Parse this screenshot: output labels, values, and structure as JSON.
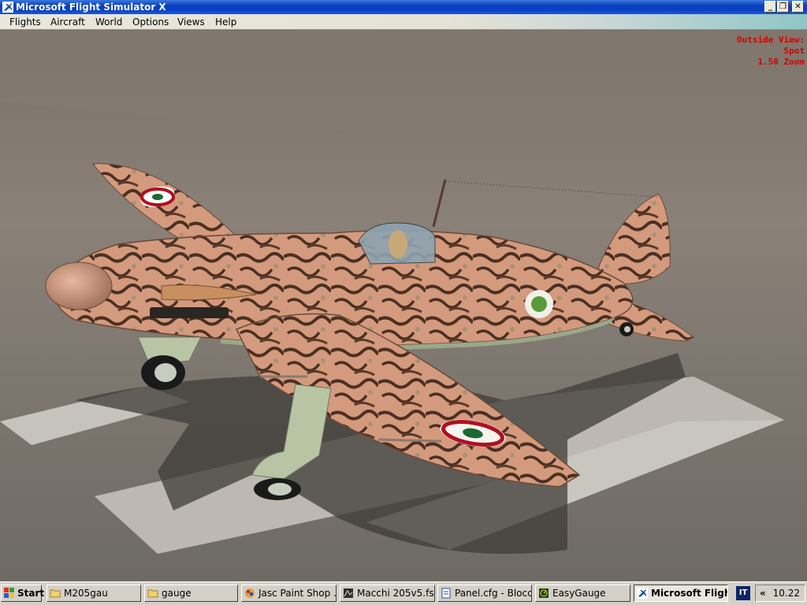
{
  "window": {
    "title": "Microsoft Flight Simulator X"
  },
  "menu": [
    "Flights",
    "Aircraft",
    "World",
    "Options",
    "Views",
    "Help"
  ],
  "view_info": {
    "line1": "Outside View:",
    "line2": "Spot",
    "line3": "1.50 Zoom"
  },
  "taskbar": {
    "start_label": "Start",
    "tasks": [
      {
        "label": "M205gau",
        "icon": "folder-icon"
      },
      {
        "label": "gauge",
        "icon": "folder-icon"
      },
      {
        "label": "Jasc Paint Shop ...",
        "icon": "paint-shop-icon"
      },
      {
        "label": "Macchi 205v5.fs...",
        "icon": "image-file-icon"
      },
      {
        "label": "Panel.cfg - Blocc...",
        "icon": "notepad-icon"
      },
      {
        "label": "EasyGauge",
        "icon": "easygauge-icon"
      },
      {
        "label": "Microsoft Fligh...",
        "icon": "flight-sim-icon"
      }
    ],
    "language": "IT",
    "chevron": "«",
    "clock": "10.22"
  },
  "colors": {
    "view_info": "#d40000",
    "titlebar": "#0a3fb8",
    "camo_base": "#d49a7e",
    "camo_mottle": "#5a3a28"
  }
}
